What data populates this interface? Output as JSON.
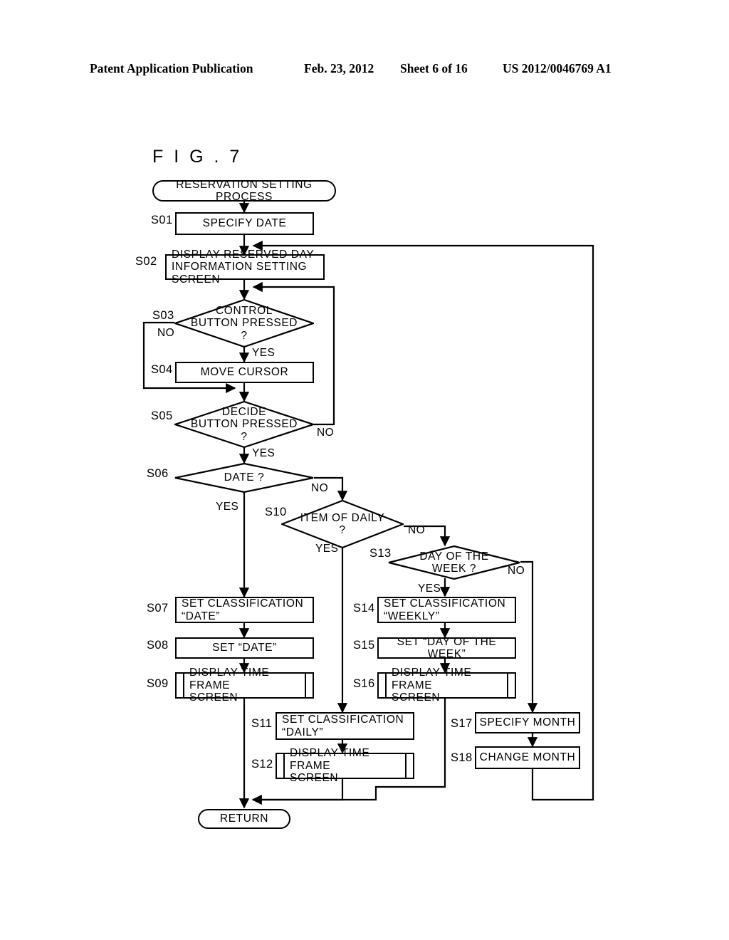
{
  "header": {
    "publication": "Patent Application Publication",
    "date": "Feb. 23, 2012",
    "sheet": "Sheet 6 of 16",
    "number": "US 2012/0046769 A1"
  },
  "figure": {
    "title": "F I G .  7"
  },
  "flowchart": {
    "start": {
      "label": "RESERVATION SETTING PROCESS"
    },
    "end": {
      "label": "RETURN"
    },
    "steps": [
      {
        "tag": "S01",
        "label": "SPECIFY DATE",
        "type": "process"
      },
      {
        "tag": "S02",
        "label": "DISPLAY RESERVED DAY\nINFORMATION SETTING SCREEN",
        "type": "process"
      },
      {
        "tag": "S03",
        "label": "CONTROL\nBUTTON PRESSED\n?",
        "type": "decision"
      },
      {
        "tag": "S04",
        "label": "MOVE CURSOR",
        "type": "process"
      },
      {
        "tag": "S05",
        "label": "DECIDE\nBUTTON PRESSED\n?",
        "type": "decision"
      },
      {
        "tag": "S06",
        "label": "DATE ?",
        "type": "decision"
      },
      {
        "tag": "S07",
        "label": "SET CLASSIFICATION\n“DATE”",
        "type": "process"
      },
      {
        "tag": "S08",
        "label": "SET “DATE”",
        "type": "process"
      },
      {
        "tag": "S09",
        "label": "DISPLAY TIME FRAME\nSCREEN",
        "type": "predefined"
      },
      {
        "tag": "S10",
        "label": "ITEM OF DAILY\n?",
        "type": "decision"
      },
      {
        "tag": "S11",
        "label": "SET CLASSIFICATION\n“DAILY”",
        "type": "process"
      },
      {
        "tag": "S12",
        "label": "DISPLAY TIME FRAME\nSCREEN",
        "type": "predefined"
      },
      {
        "tag": "S13",
        "label": "DAY OF THE\nWEEK ?",
        "type": "decision"
      },
      {
        "tag": "S14",
        "label": "SET CLASSIFICATION\n“WEEKLY”",
        "type": "process"
      },
      {
        "tag": "S15",
        "label": "SET “DAY OF THE WEEK”",
        "type": "process"
      },
      {
        "tag": "S16",
        "label": "DISPLAY TIME FRAME\nSCREEN",
        "type": "predefined"
      },
      {
        "tag": "S17",
        "label": "SPECIFY MONTH",
        "type": "process"
      },
      {
        "tag": "S18",
        "label": "CHANGE MONTH",
        "type": "process"
      }
    ],
    "edge_labels": {
      "s03_no": "NO",
      "s03_yes": "YES",
      "s05_no": "NO",
      "s05_yes": "YES",
      "s06_yes": "YES",
      "s06_no": "NO",
      "s10_yes": "YES",
      "s10_no": "NO",
      "s13_yes": "YES",
      "s13_no": "NO"
    }
  },
  "colors": {
    "ink": "#000000",
    "paper": "#ffffff"
  }
}
